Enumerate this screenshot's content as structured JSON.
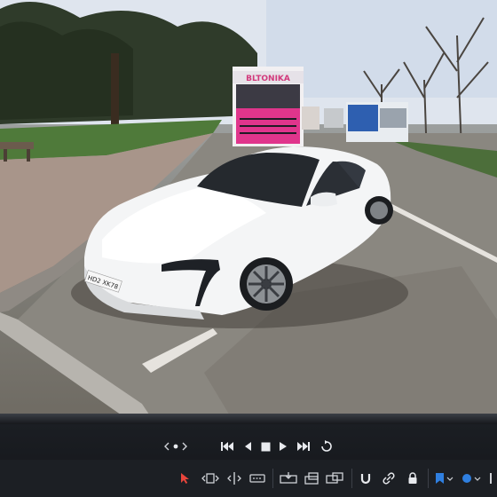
{
  "viewer": {
    "image_description_free": true,
    "plate_text": "HD2 XK78",
    "truck_brand_text": "BLTONIKA"
  },
  "transport": {
    "nav_icon": "prev-next-dots-icon",
    "skip_back_icon": "skip-back-icon",
    "step_back_icon": "step-back-icon",
    "stop_icon": "stop-icon",
    "play_icon": "play-icon",
    "skip_forward_icon": "skip-forward-icon",
    "loop_icon": "loop-icon"
  },
  "tools": {
    "items": [
      "pointer-tool",
      "trim-tool",
      "split-tool",
      "blade-tool",
      "insert-tool",
      "overwrite-tool",
      "replace-tool",
      "snap-tool",
      "link-tool",
      "lock-tool",
      "flag-tool",
      "marker-tool"
    ],
    "pointer_color": "#e8453c",
    "accent": "#2f7fe0"
  }
}
